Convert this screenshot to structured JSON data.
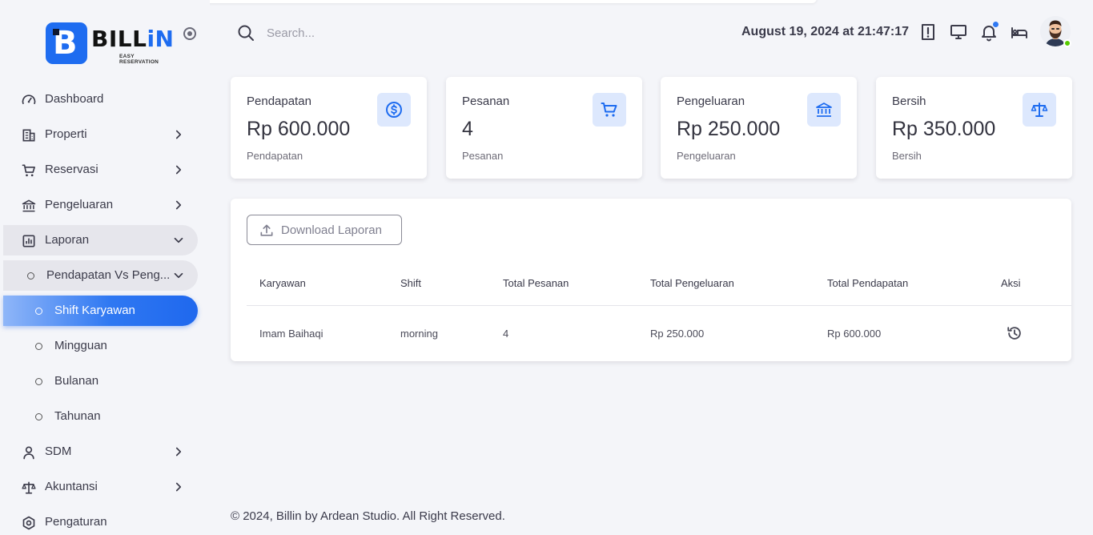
{
  "brand": {
    "name_prefix": "BILL",
    "name_suffix": "iN",
    "tagline": "EASY RESERVATION",
    "accent_color": "#1e6cf0"
  },
  "sidebar": {
    "items": [
      {
        "label": "Dashboard",
        "icon": "gauge-icon"
      },
      {
        "label": "Properti",
        "icon": "building-icon"
      },
      {
        "label": "Reservasi",
        "icon": "cart-icon"
      },
      {
        "label": "Pengeluaran",
        "icon": "bank-icon"
      },
      {
        "label": "Laporan",
        "icon": "report-chart-icon"
      },
      {
        "label": "Pendapatan Vs Peng...",
        "icon": "circle-icon"
      },
      {
        "label": "Shift Karyawan",
        "icon": "circle-icon"
      },
      {
        "label": "Mingguan",
        "icon": "circle-icon"
      },
      {
        "label": "Bulanan",
        "icon": "circle-icon"
      },
      {
        "label": "Tahunan",
        "icon": "circle-icon"
      },
      {
        "label": "SDM",
        "icon": "user-icon"
      },
      {
        "label": "Akuntansi",
        "icon": "scale-icon"
      },
      {
        "label": "Pengaturan",
        "icon": "settings-hex-icon"
      }
    ],
    "active_color": "#1f68ee"
  },
  "header": {
    "search_placeholder": "Search...",
    "datetime": "August 19, 2024 at 21:47:17",
    "icons": [
      "alert-icon",
      "monitor-icon",
      "bell-icon",
      "bed-icon"
    ]
  },
  "cards": [
    {
      "title": "Pendapatan",
      "value": "Rp 600.000",
      "subtitle": "Pendapatan",
      "icon": "dollar-circle-icon"
    },
    {
      "title": "Pesanan",
      "value": "4",
      "subtitle": "Pesanan",
      "icon": "cart-icon"
    },
    {
      "title": "Pengeluaran",
      "value": "Rp 250.000",
      "subtitle": "Pengeluaran",
      "icon": "bank-icon"
    },
    {
      "title": "Bersih",
      "value": "Rp 350.000",
      "subtitle": "Bersih",
      "icon": "scale-icon"
    }
  ],
  "report": {
    "download_label": "Download Laporan",
    "columns": [
      "Karyawan",
      "Shift",
      "Total Pesanan",
      "Total Pengeluaran",
      "Total Pendapatan",
      "Aksi"
    ],
    "rows": [
      {
        "karyawan": "Imam Baihaqi",
        "shift": "morning",
        "total_pesanan": "4",
        "total_pengeluaran": "Rp 250.000",
        "total_pendapatan": "Rp 600.000",
        "aksi_icon": "history-icon"
      }
    ]
  },
  "footer": {
    "text": "© 2024, Billin by Ardean Studio. All Right Reserved."
  }
}
